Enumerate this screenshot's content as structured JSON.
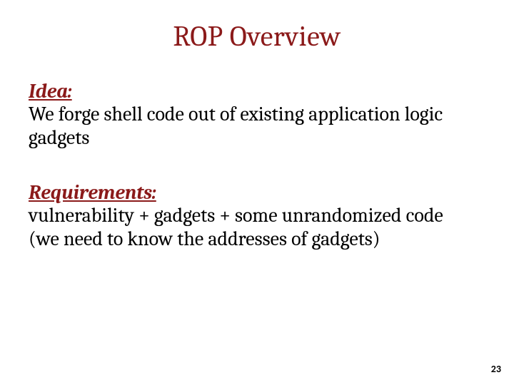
{
  "title": "ROP Overview",
  "sections": [
    {
      "heading": "Idea:",
      "body": "We forge shell code out of existing application logic gadgets"
    },
    {
      "heading": "Requirements:",
      "body": "vulnerability + gadgets + some unrandomized code\n(we need to know the addresses of gadgets)"
    }
  ],
  "page_number": "23"
}
